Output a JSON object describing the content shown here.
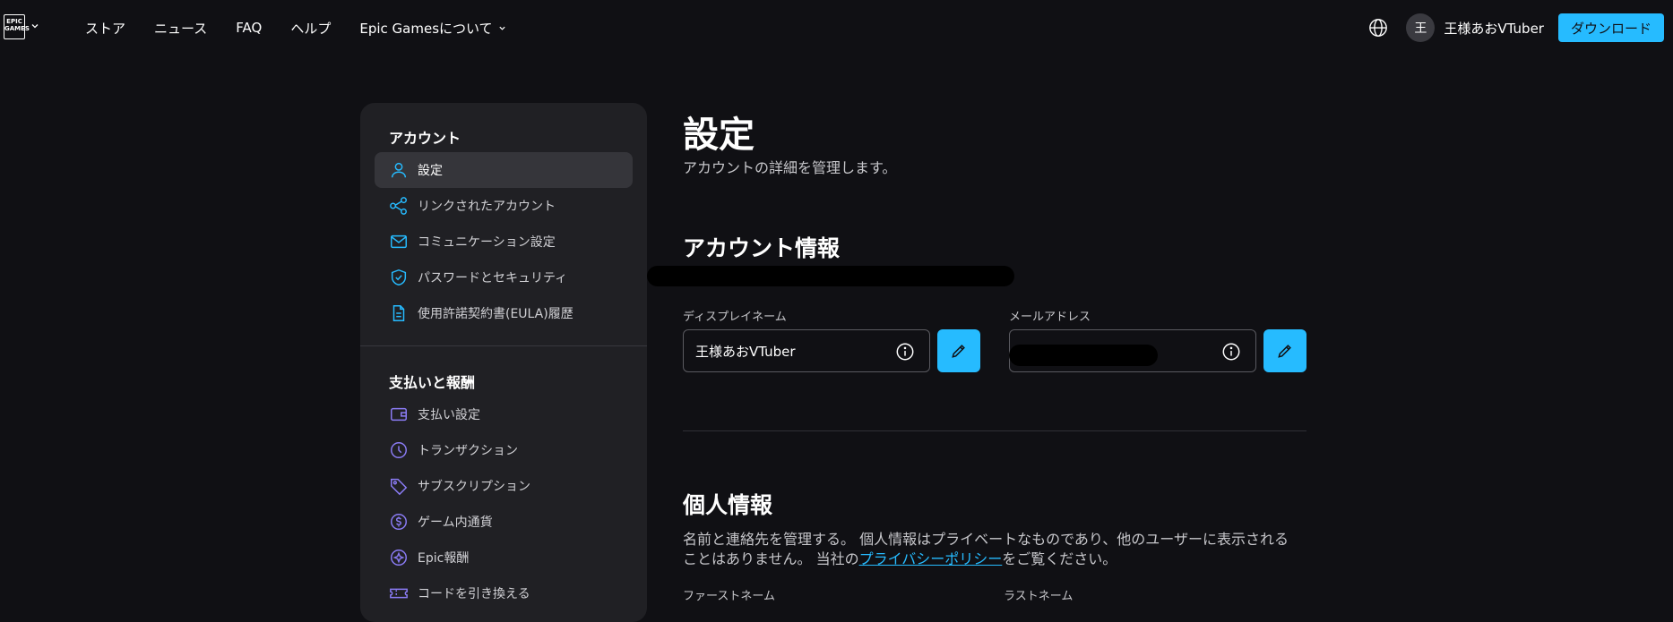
{
  "header": {
    "logo_text": "EPIC GAMES",
    "nav": [
      {
        "label": "ストア"
      },
      {
        "label": "ニュース"
      },
      {
        "label": "FAQ"
      },
      {
        "label": "ヘルプ"
      },
      {
        "label": "Epic Gamesについて"
      }
    ],
    "avatar_initial": "王",
    "username": "王様あおVTuber",
    "download_label": "ダウンロード"
  },
  "sidebar": {
    "account_title": "アカウント",
    "account_items": [
      {
        "label": "設定",
        "icon": "person-icon",
        "active": true
      },
      {
        "label": "リンクされたアカウント",
        "icon": "share-icon"
      },
      {
        "label": "コミュニケーション設定",
        "icon": "mail-icon"
      },
      {
        "label": "パスワードとセキュリティ",
        "icon": "shield-icon"
      },
      {
        "label": "使用許諾契約書(EULA)履歴",
        "icon": "document-icon"
      }
    ],
    "payment_title": "支払いと報酬",
    "payment_items": [
      {
        "label": "支払い設定",
        "icon": "wallet-icon"
      },
      {
        "label": "トランザクション",
        "icon": "clock-icon"
      },
      {
        "label": "サブスクリプション",
        "icon": "tag-icon"
      },
      {
        "label": "ゲーム内通貨",
        "icon": "coin-icon"
      },
      {
        "label": "Epic報酬",
        "icon": "star-icon"
      },
      {
        "label": "コードを引き換える",
        "icon": "ticket-icon"
      }
    ]
  },
  "main": {
    "title": "設定",
    "subtitle": "アカウントの詳細を管理します。",
    "account_info_title": "アカウント情報",
    "display_name_label": "ディスプレイネーム",
    "display_name_value": "王様あおVTuber",
    "email_label": "メールアドレス",
    "personal_title": "個人情報",
    "personal_text_1": "名前と連絡先を管理する。 個人情報はプライベートなものであり、他のユーザーに表示される",
    "personal_text_2a": "ことはありません。 当社の",
    "privacy_link": "プライバシーポリシー",
    "personal_text_2b": "をご覧ください。",
    "first_name_label": "ファーストネーム",
    "last_name_label": "ラストネーム"
  },
  "colors": {
    "background": "#101014",
    "sidebar": "#202024",
    "accent": "#26bbff"
  }
}
